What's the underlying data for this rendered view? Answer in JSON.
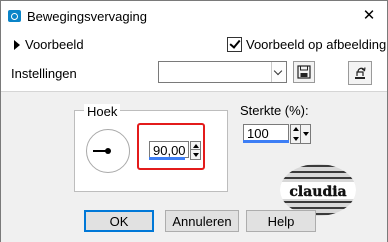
{
  "window": {
    "title": "Bewegingsvervaging",
    "close_glyph": "✕"
  },
  "preview": {
    "toggle_label": "Voorbeeld",
    "checkbox_label": "Voorbeeld op afbeelding",
    "checkbox_checked": true
  },
  "settings": {
    "label": "Instellingen",
    "preset_value": ""
  },
  "angle": {
    "group_label": "Hoek",
    "value": "90,00"
  },
  "strength": {
    "label": "Sterkte (%):",
    "value": "100"
  },
  "watermark": {
    "text": "claudia"
  },
  "buttons": {
    "ok": "OK",
    "cancel": "Annuleren",
    "help": "Help"
  },
  "icons": {
    "app": "app-icon",
    "save": "save-preset-icon",
    "reset": "reset-icon",
    "close": "close-icon"
  },
  "colors": {
    "highlight": "#e31b1b",
    "accent": "#0078d7",
    "input_bar": "#3d7ef5"
  }
}
